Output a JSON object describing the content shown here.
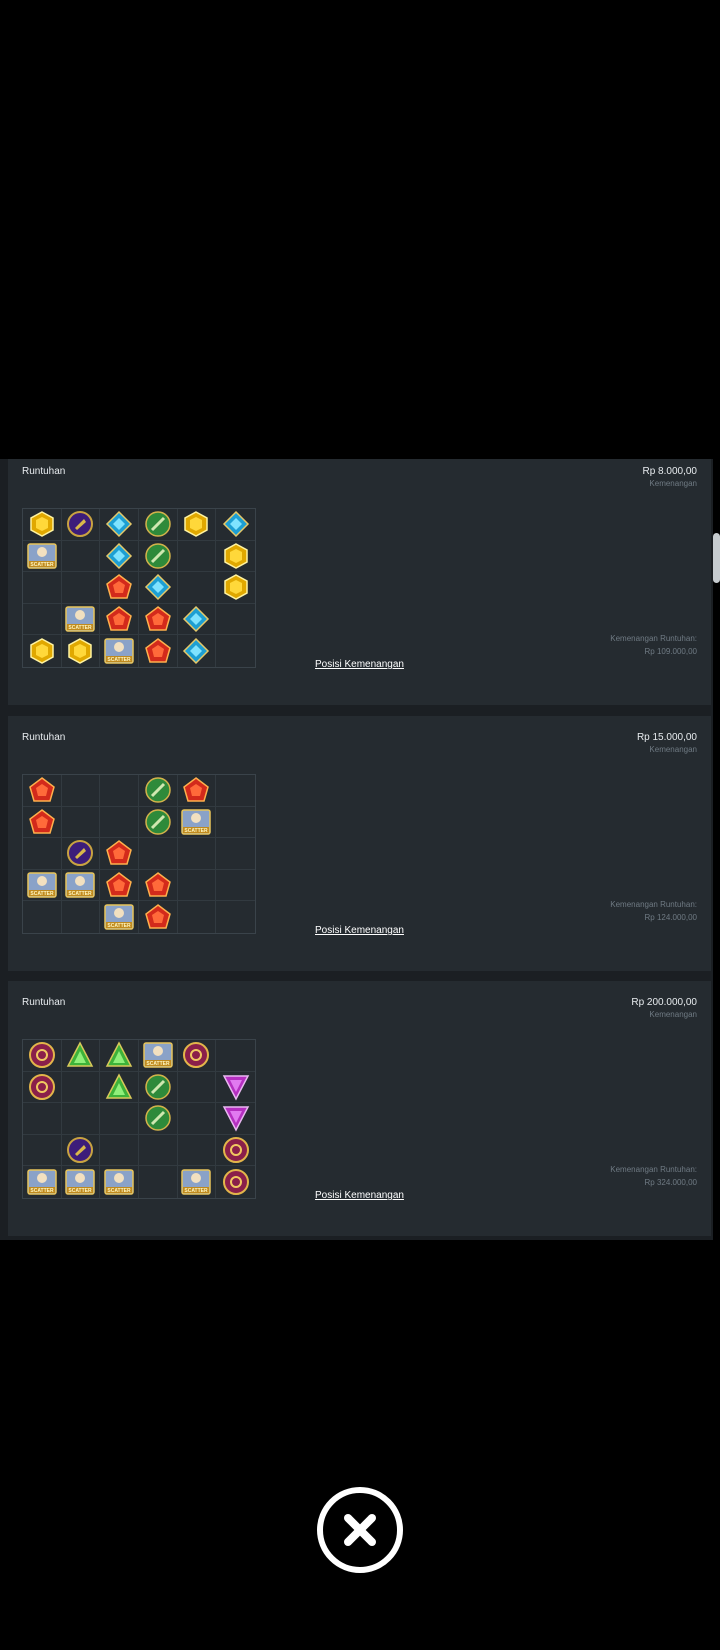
{
  "cards": [
    {
      "title": "Runtuhan",
      "amount": "Rp 8.000,00",
      "amount_label": "Kemenangan",
      "cascade_label": "Kemenangan Runtuhan:",
      "cascade_value": "Rp 109.000,00",
      "win_positions": "Posisi Kemenangan",
      "grid": [
        [
          "gold",
          "purple",
          "blue",
          "green",
          "gold",
          "blue"
        ],
        [
          "scatter",
          "",
          "blue",
          "green",
          "",
          "gold"
        ],
        [
          "",
          "",
          "red",
          "blue",
          "",
          "gold"
        ],
        [
          "",
          "scatter",
          "red",
          "red",
          "blue",
          ""
        ],
        [
          "gold",
          "gold",
          "scatter",
          "red",
          "blue",
          ""
        ]
      ]
    },
    {
      "title": "Runtuhan",
      "amount": "Rp 15.000,00",
      "amount_label": "Kemenangan",
      "cascade_label": "Kemenangan Runtuhan:",
      "cascade_value": "Rp 124.000,00",
      "win_positions": "Posisi Kemenangan",
      "grid": [
        [
          "red",
          "",
          "",
          "green",
          "red",
          ""
        ],
        [
          "red",
          "",
          "",
          "green",
          "scatter",
          ""
        ],
        [
          "",
          "purple",
          "red",
          "",
          "",
          ""
        ],
        [
          "scatter",
          "scatter",
          "red",
          "red",
          "",
          ""
        ],
        [
          "",
          "",
          "scatter",
          "red",
          "",
          ""
        ]
      ]
    },
    {
      "title": "Runtuhan",
      "amount": "Rp 200.000,00",
      "amount_label": "Kemenangan",
      "cascade_label": "Kemenangan Runtuhan:",
      "cascade_value": "Rp 324.000,00",
      "win_positions": "Posisi Kemenangan",
      "grid": [
        [
          "ring",
          "triangle",
          "triangle",
          "scatter",
          "ring",
          ""
        ],
        [
          "ring",
          "",
          "triangle",
          "green",
          "",
          "pinktri"
        ],
        [
          "",
          "",
          "",
          "green",
          "",
          "pinktri"
        ],
        [
          "",
          "purple",
          "",
          "",
          "",
          "ring"
        ],
        [
          "scatter",
          "scatter",
          "scatter",
          "",
          "scatter",
          "ring"
        ]
      ]
    }
  ],
  "scatter_text": "SCATTER",
  "close_icon": "close-circle-icon"
}
